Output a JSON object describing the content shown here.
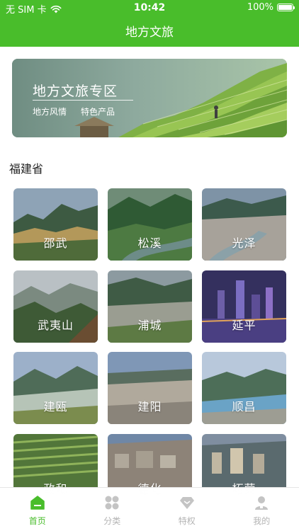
{
  "status_bar": {
    "carrier": "无 SIM 卡",
    "time": "10:42",
    "battery": "100%"
  },
  "header": {
    "title": "地方文旅"
  },
  "banner": {
    "title": "地方文旅专区",
    "tags": [
      "地方风情",
      "特色产品"
    ]
  },
  "province": "福建省",
  "cities": [
    {
      "name": "邵武"
    },
    {
      "name": "松溪"
    },
    {
      "name": "光泽"
    },
    {
      "name": "武夷山"
    },
    {
      "name": "浦城"
    },
    {
      "name": "延平"
    },
    {
      "name": "建瓯"
    },
    {
      "name": "建阳"
    },
    {
      "name": "顺昌"
    },
    {
      "name": "政和"
    },
    {
      "name": "德化"
    },
    {
      "name": "柘荣"
    }
  ],
  "tabbar": [
    {
      "label": "首页",
      "icon": "home-icon",
      "active": true
    },
    {
      "label": "分类",
      "icon": "category-icon",
      "active": false
    },
    {
      "label": "特权",
      "icon": "diamond-icon",
      "active": false
    },
    {
      "label": "我的",
      "icon": "user-icon",
      "active": false
    }
  ],
  "colors": {
    "brand": "#49bd2b",
    "tab_inactive": "#b3b3b3"
  }
}
